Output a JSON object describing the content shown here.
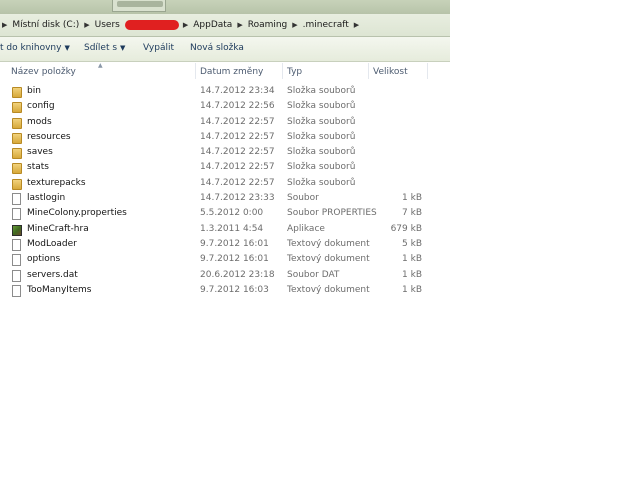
{
  "address": {
    "crumbs": [
      "Místní disk (C:)",
      "Users",
      "AppData",
      "Roaming",
      ".minecraft"
    ]
  },
  "toolbar": {
    "include_label": "t do knihovny",
    "share_label": "Sdílet s",
    "burn_label": "Vypálit",
    "new_folder_label": "Nová složka"
  },
  "columns": {
    "name": "Název položky",
    "date": "Datum změny",
    "type": "Typ",
    "size": "Velikost"
  },
  "files": [
    {
      "name": "bin",
      "date": "14.7.2012 23:34",
      "type": "Složka souborů",
      "size": "",
      "icon": "folder-icon"
    },
    {
      "name": "config",
      "date": "14.7.2012 22:56",
      "type": "Složka souborů",
      "size": "",
      "icon": "folder-icon"
    },
    {
      "name": "mods",
      "date": "14.7.2012 22:57",
      "type": "Složka souborů",
      "size": "",
      "icon": "folder-icon"
    },
    {
      "name": "resources",
      "date": "14.7.2012 22:57",
      "type": "Složka souborů",
      "size": "",
      "icon": "folder-icon"
    },
    {
      "name": "saves",
      "date": "14.7.2012 22:57",
      "type": "Složka souborů",
      "size": "",
      "icon": "folder-icon"
    },
    {
      "name": "stats",
      "date": "14.7.2012 22:57",
      "type": "Složka souborů",
      "size": "",
      "icon": "folder-icon"
    },
    {
      "name": "texturepacks",
      "date": "14.7.2012 22:57",
      "type": "Složka souborů",
      "size": "",
      "icon": "folder-icon"
    },
    {
      "name": "lastlogin",
      "date": "14.7.2012 23:33",
      "type": "Soubor",
      "size": "1 kB",
      "icon": "file-icon"
    },
    {
      "name": "MineColony.properties",
      "date": "5.5.2012 0:00",
      "type": "Soubor PROPERTIES",
      "size": "7 kB",
      "icon": "file-icon"
    },
    {
      "name": "MineCraft-hra",
      "date": "1.3.2011 4:54",
      "type": "Aplikace",
      "size": "679 kB",
      "icon": "app-icon"
    },
    {
      "name": "ModLoader",
      "date": "9.7.2012 16:01",
      "type": "Textový dokument",
      "size": "5 kB",
      "icon": "file-icon"
    },
    {
      "name": "options",
      "date": "9.7.2012 16:01",
      "type": "Textový dokument",
      "size": "1 kB",
      "icon": "file-icon"
    },
    {
      "name": "servers.dat",
      "date": "20.6.2012 23:18",
      "type": "Soubor DAT",
      "size": "1 kB",
      "icon": "file-icon"
    },
    {
      "name": "TooManyItems",
      "date": "9.7.2012 16:03",
      "type": "Textový dokument",
      "size": "1 kB",
      "icon": "file-icon"
    }
  ]
}
